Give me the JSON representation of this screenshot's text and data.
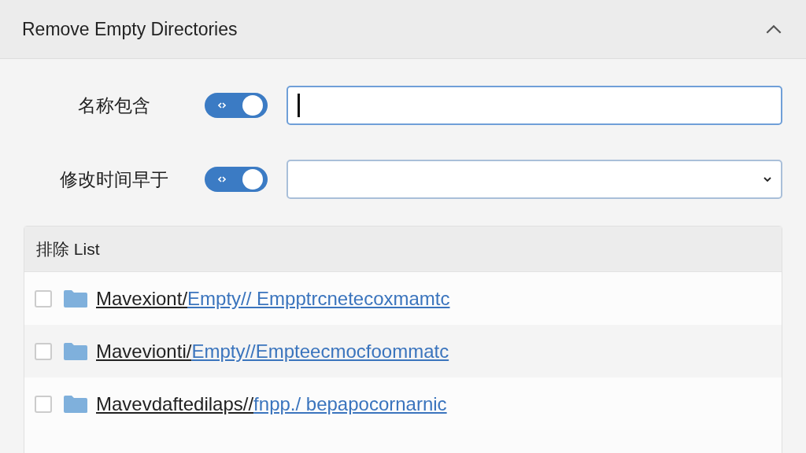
{
  "panel": {
    "title": "Remove Empty Directories",
    "expanded": true
  },
  "filters": [
    {
      "label": "名称包含",
      "on": true,
      "kind": "text",
      "focused": true
    },
    {
      "label": "修改时间早于",
      "on": true,
      "kind": "select",
      "focused": false
    }
  ],
  "exclude_list": {
    "title": "排除 List",
    "items": [
      {
        "checked": false,
        "prefix": "Mavexiont/",
        "link": "Empty// Empptrcnetecoxmamtc"
      },
      {
        "checked": false,
        "prefix": "Mavevionti/",
        "link": "Empty//Empteecmocfoommatc"
      },
      {
        "checked": false,
        "prefix": "Mavevdaftedilaps//",
        "link": "fnpp./ bepapocornarnic"
      }
    ]
  }
}
